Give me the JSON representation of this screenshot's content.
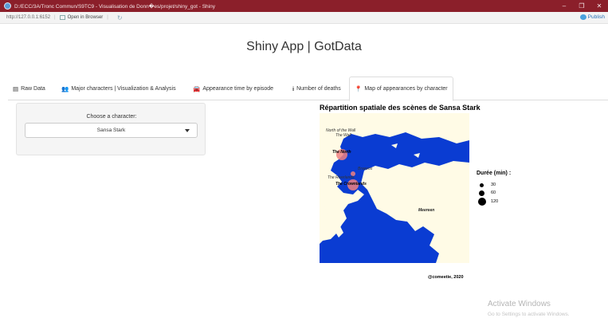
{
  "window": {
    "title": "D:/ECC/3A/Tronc Commun/S9TC9 - Visualisation de Donn�es/projet/shiny_got - Shiny"
  },
  "addressbar": {
    "url": "http://127.0.0.1:6152",
    "open_in_browser": "Open in Browser",
    "publish": "Publish"
  },
  "app": {
    "title": "Shiny App | GotData"
  },
  "tabs": [
    {
      "label": "Raw Data",
      "icon": "table-icon"
    },
    {
      "label": "Major characters | Visualization & Analysis",
      "icon": "users-icon"
    },
    {
      "label": "Appearance time by episode",
      "icon": "car-icon"
    },
    {
      "label": "Number of deaths",
      "icon": "info-icon"
    },
    {
      "label": "Map of appearances by character",
      "icon": "map-marker-icon",
      "active": true
    }
  ],
  "sidebar": {
    "choose_label": "Choose a character:",
    "selected": "Sansa Stark"
  },
  "plot": {
    "title": "Répartition spatiale des scènes de Sansa Stark",
    "legend_title": "Durée (min) :",
    "legend_values": [
      "30",
      "60",
      "120"
    ],
    "caption": "@comeetie, 2020",
    "regions": [
      "North of the Wall",
      "The Wall",
      "The North",
      "Braavos",
      "The Riverlands",
      "The Crownlands",
      "Meereen"
    ],
    "colors": {
      "land": "#fffbe6",
      "sea": "#0a3cd2",
      "bubble": "#f08080"
    }
  },
  "watermark": {
    "title": "Activate Windows",
    "subtitle": "Go to Settings to activate Windows."
  }
}
